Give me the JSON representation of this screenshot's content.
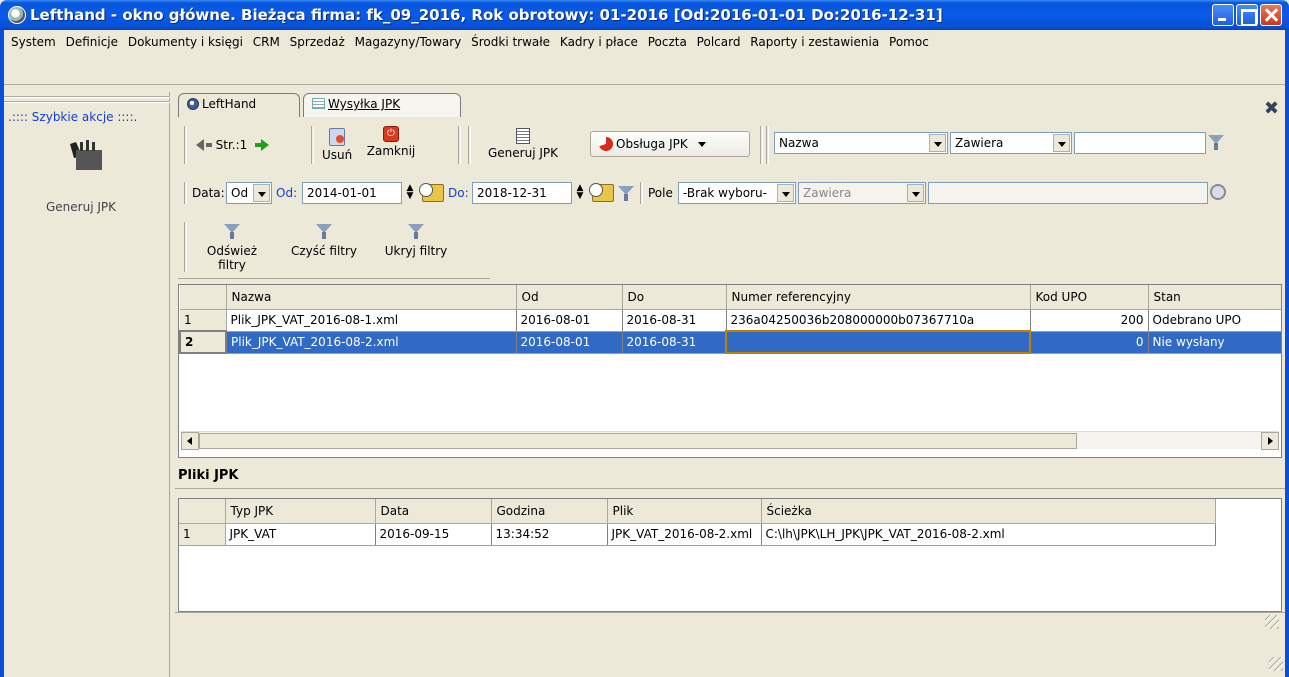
{
  "window": {
    "title": "Lefthand - okno główne. Bieżąca firma: fk_09_2016, Rok obrotowy: 01-2016 [Od:2016-01-01 Do:2016-12-31]"
  },
  "menu": {
    "items": [
      "System",
      "Definicje",
      "Dokumenty i księgi",
      "CRM",
      "Sprzedaż",
      "Magazyny/Towary",
      "Środki trwałe",
      "Kadry i płace",
      "Poczta",
      "Polcard",
      "Raporty i zestawienia",
      "Pomoc"
    ]
  },
  "left_panel": {
    "header": ".:::: Szybkie akcje ::::.",
    "action_label": "Generuj JPK"
  },
  "tabs": [
    {
      "label": "LeftHand"
    },
    {
      "label": "Wysyłka JPK"
    }
  ],
  "toolbar": {
    "page_label": "Str.:1",
    "delete_label": "Usuń",
    "close_label": "Zamknij",
    "generate_label": "Generuj JPK",
    "jpk_service_label": "Obsługa JPK",
    "filter_field_value": "Nazwa",
    "filter_op_value": "Zawiera",
    "filter_text_value": ""
  },
  "date_filter": {
    "label": "Data:",
    "mode_value": "Od",
    "from_label": "Od:",
    "from_value": "2014-01-01",
    "to_label": "Do:",
    "to_value": "2018-12-31",
    "pole_label": "Pole",
    "pole_value": "-Brak wyboru-",
    "pole_op_value": "Zawiera"
  },
  "filter_buttons": {
    "refresh_label": "Odśwież filtry",
    "clear_label": "Czyść filtry",
    "hide_label": "Ukryj filtry"
  },
  "main_grid": {
    "columns": [
      "Nazwa",
      "Od",
      "Do",
      "Numer referencyjny",
      "Kod UPO",
      "Stan"
    ],
    "rows": [
      {
        "n": "1",
        "nazwa": "Plik_JPK_VAT_2016-08-1.xml",
        "od": "2016-08-01",
        "do": "2016-08-31",
        "ref": "236a04250036b208000000b07367710a",
        "kod": "200",
        "stan": "Odebrano UPO"
      },
      {
        "n": "2",
        "nazwa": "Plik_JPK_VAT_2016-08-2.xml",
        "od": "2016-08-01",
        "do": "2016-08-31",
        "ref": "",
        "kod": "0",
        "stan": "Nie wysłany"
      }
    ]
  },
  "files_section": {
    "title": "Pliki JPK",
    "columns": [
      "Typ JPK",
      "Data",
      "Godzina",
      "Plik",
      "Ścieżka"
    ],
    "rows": [
      {
        "n": "1",
        "typ": "JPK_VAT",
        "data": "2016-09-15",
        "godzina": "13:34:52",
        "plik": "JPK_VAT_2016-08-2.xml",
        "sciezka": "C:\\lh\\JPK\\LH_JPK\\JPK_VAT_2016-08-2.xml"
      }
    ]
  },
  "colors": {
    "title_bar": "#0a5ae8",
    "selection": "#316ac5",
    "link_blue": "#1a3cd0",
    "window_bg": "#ece9d8"
  }
}
